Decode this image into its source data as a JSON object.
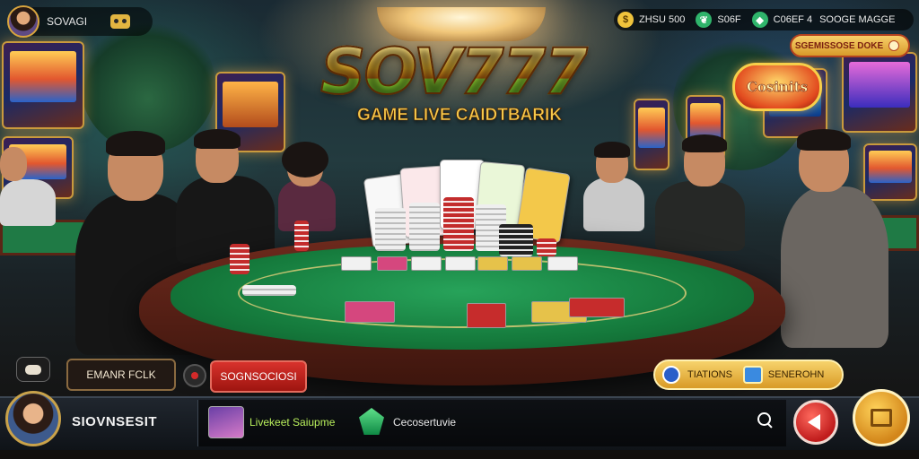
{
  "header": {
    "player_name": "SOVAGI",
    "stats": [
      {
        "icon": "coin-icon",
        "value": "ZHSU 500"
      },
      {
        "icon": "leaf-icon",
        "value": "S06F"
      },
      {
        "icon": "gem-icon",
        "value": "C06EF 4"
      },
      {
        "icon": "",
        "value": "SOOGE MAGGE"
      }
    ],
    "promo_label": "SGEMISSOSE   DOKE"
  },
  "title": {
    "logo": "SOV777",
    "subtitle": "GAME LIVE CAIDTBARIK",
    "casino_badge": "Cosinits"
  },
  "controls": {
    "dark_button_label": "EMANR FCLK",
    "red_button_label": "SOGNSOCIOSI",
    "gold_button_left": "TIATIONS",
    "gold_button_right": "SENEROHN"
  },
  "footer": {
    "user_name": "SIOVNSESIT",
    "item_a_label": "Livekeet Saiupme",
    "item_b_label": "Cecosertuvie"
  },
  "colors": {
    "accent_gold": "#f3b92c",
    "accent_green": "#3c8b18",
    "button_red": "#c01c1c",
    "felt_green": "#157a3c"
  }
}
